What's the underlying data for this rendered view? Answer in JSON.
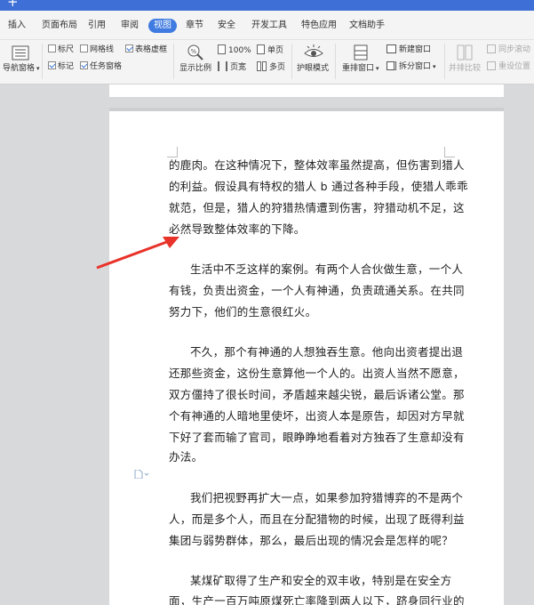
{
  "titlebar": {
    "new_tab": "+"
  },
  "menu": {
    "items": [
      "插入",
      "页面布局",
      "引用",
      "审阅",
      "视图",
      "章节",
      "安全",
      "开发工具",
      "特色应用",
      "文档助手"
    ],
    "active": "视图"
  },
  "ribbon": {
    "nav_pane": "导航窗格",
    "ruler": "标尺",
    "gridlines": "网格线",
    "table_gridlines": "表格虚框",
    "marks": "标记",
    "task_pane": "任务窗格",
    "display_ratio": "显示比例",
    "zoom_100": "100%",
    "page_width": "页宽",
    "single_page": "单页",
    "multi_page": "多页",
    "eye_mode": "护眼模式",
    "arrange_windows": "重排窗口",
    "new_window": "新建窗口",
    "split_window": "拆分窗口",
    "side_by_side": "并排比较",
    "sync_scroll": "同步滚动",
    "reset_position": "重设位置"
  },
  "document": {
    "lines": [
      "的鹿肉。在这种情况下，整体效率虽然提高，但伤害到猎人",
      "的利益。假设具有特权的猎人 b 通过各种手段，使猎人乖乖",
      "就范，但是，猎人的狩猎热情遭到伤害，狩猎动机不足，这",
      "必然导致整体效率的下降。",
      "生活中不乏这样的案例。有两个人合伙做生意，一个人",
      "有钱，负责出资金，一个人有神通，负责疏通关系。在共同",
      "努力下，他们的生意很红火。",
      "不久，那个有神通的人想独吞生意。他向出资者提出退",
      "还那些资金，这份生意算他一个人的。出资人当然不愿意，",
      "双方僵持了很长时间，矛盾越来越尖锐，最后诉诸公堂。那",
      "个有神通的人暗地里使坏，出资人本是原告，却因对方早就",
      "下好了套而输了官司，眼睁睁地看着对方独吞了生意却没有",
      "办法。",
      "我们把视野再扩大一点，如果参加狩猎博弈的不是两个",
      "人，而是多个人，而且在分配猎物的时候，出现了既得利益",
      "集团与弱势群体，那么，最后出现的情况会是怎样的呢？",
      "某煤矿取得了生产和安全的双丰收，特别是在安全方",
      "面，生产一百万吨原煤死亡率降到两人以下，跻身同行业的"
    ]
  },
  "colors": {
    "accent": "#3f7be0",
    "annotation_arrow": "#e8332a"
  }
}
